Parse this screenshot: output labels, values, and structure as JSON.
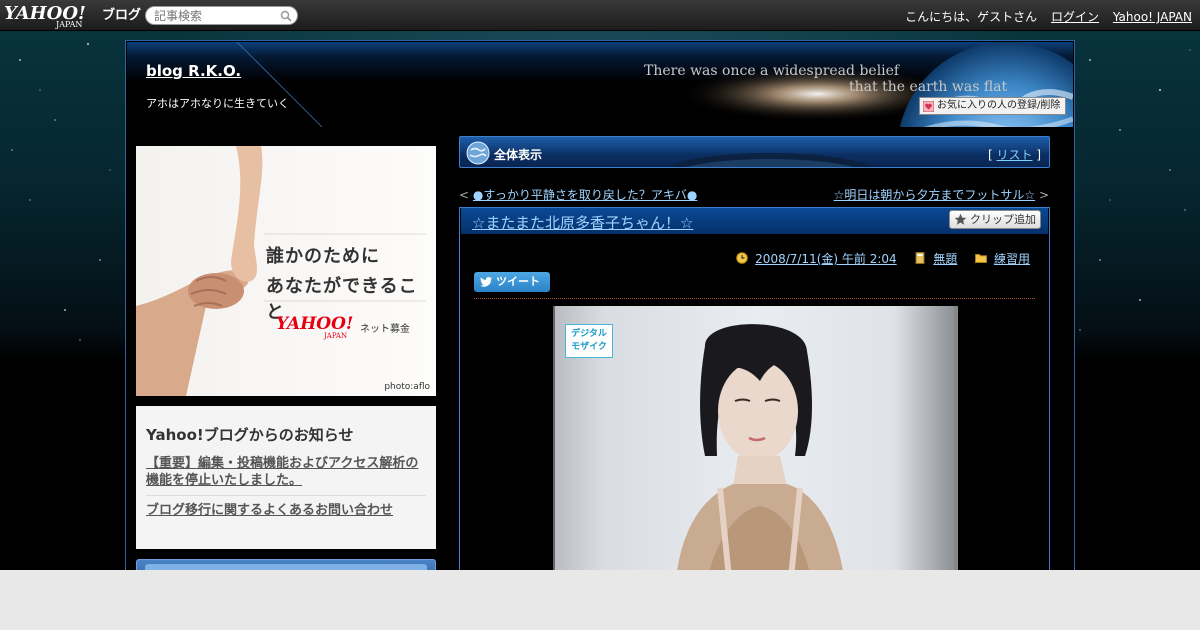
{
  "masthead": {
    "logo_text": "YAHOO!",
    "logo_sub": "JAPAN",
    "logo_blog": "ブログ",
    "search_placeholder": "記事検索",
    "greeting": "こんにちは、ゲストさん",
    "login_label": "ログイン",
    "yahoo_japan_label": "Yahoo! JAPAN"
  },
  "blog": {
    "title": "blog R.K.O.",
    "description": "アホはアホなりに生きていく",
    "header_art_text_line1": "There was once a widespread belief",
    "header_art_text_line2": "that the earth was flat",
    "favorite_button_label": "お気に入りの人の登録/削除"
  },
  "sidebar": {
    "banner": {
      "line1": "誰かのために",
      "line2": "あなたができること",
      "logo": "YAHOO!",
      "logo_sub": "JAPAN",
      "tagline": "ネット募金",
      "credit": "photo:aflo"
    },
    "notices": {
      "title": "Yahoo!ブログからのお知らせ",
      "items": [
        "【重要】編集・投稿機能およびアクセス解析の機能を停止いたしました。",
        "ブログ移行に関するよくあるお問い合わせ"
      ]
    }
  },
  "main": {
    "list_header": {
      "title": "全体表示",
      "bracket_open": "[",
      "list_link": "リスト",
      "bracket_close": "]"
    },
    "nav": {
      "prev_prefix": "<",
      "prev_label": "●すっかり平静さを取り戻した？アキバ●",
      "next_label": "☆明日は朝から夕方までフットサル☆",
      "next_suffix": ">"
    },
    "article": {
      "title": "☆またまた北原多香子ちゃん！☆",
      "clip_label": "クリップ追加",
      "date": "2008/7/11(金) 午前 2:04",
      "theme": "無題",
      "category": "練習用",
      "tweet_label": "ツイート",
      "photo_badge_line1": "デジタル",
      "photo_badge_line2": "モザイク"
    }
  },
  "colors": {
    "link_blue": "#9fd3ff",
    "header_blue": "#0a4a95",
    "border_blue": "#3f7ecd",
    "yahoo_red": "#e60012",
    "tweet_blue": "#2b83c8"
  },
  "icons": {
    "search": "search-icon",
    "favorite": "heart-icon",
    "globe": "globe-icon",
    "clip": "star-icon",
    "clock": "clock-icon",
    "theme": "book-icon",
    "category": "folder-icon",
    "tweet": "twitter-bird-icon"
  }
}
